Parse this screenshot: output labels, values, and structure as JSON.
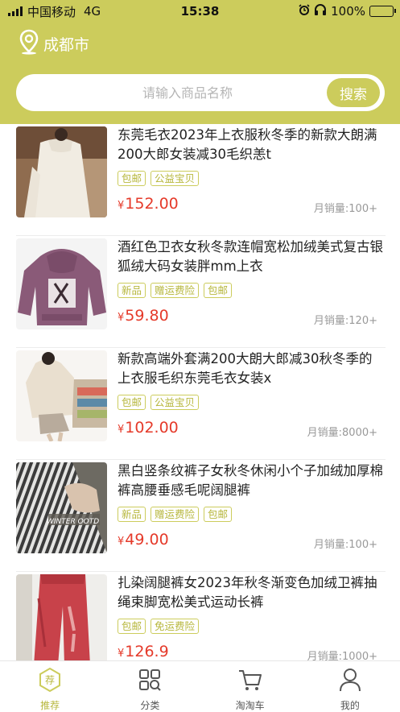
{
  "status_bar": {
    "carrier": "中国移动",
    "network": "4G",
    "time": "15:38",
    "battery": "100%",
    "battery_level": 1.0,
    "icons": [
      "signal-icon",
      "alarm-icon",
      "headphones-icon",
      "battery-charging-icon"
    ]
  },
  "header": {
    "city": "成都市",
    "location_icon": "location-pin-icon",
    "accent_color": "#cccc5c"
  },
  "search": {
    "placeholder": "请输入商品名称",
    "button_label": "搜索"
  },
  "products": [
    {
      "title": "东莞毛衣2023年上衣服秋冬季的新款大朗满200大郎女装减30毛织恙t",
      "tags": [
        "包邮",
        "公益宝贝"
      ],
      "currency": "¥",
      "price": "152.00",
      "sales": "月销量:100+"
    },
    {
      "title": "酒红色卫衣女秋冬款连帽宽松加绒美式复古银狐绒大码女装胖mm上衣",
      "tags": [
        "新品",
        "赠运费险",
        "包邮"
      ],
      "currency": "¥",
      "price": "59.80",
      "sales": "月销量:120+"
    },
    {
      "title": "新款高端外套满200大朗大郎减30秋冬季的上衣服毛织东莞毛衣女装x",
      "tags": [
        "包邮",
        "公益宝贝"
      ],
      "currency": "¥",
      "price": "102.00",
      "sales": "月销量:8000+"
    },
    {
      "title": "黑白竖条纹裤子女秋冬休闲小个子加绒加厚棉裤高腰垂感毛呢阔腿裤",
      "tags": [
        "新品",
        "赠运费险",
        "包邮"
      ],
      "currency": "¥",
      "price": "49.00",
      "sales": "月销量:100+",
      "image_caption": "WINTER OOTD"
    },
    {
      "title": "扎染阔腿裤女2023年秋冬渐变色加绒卫裤抽绳束脚宽松美式运动长裤",
      "tags": [
        "包邮",
        "免运费险"
      ],
      "currency": "¥",
      "price": "126.9",
      "sales": "月销量:1000+"
    }
  ],
  "tabbar": {
    "tabs": [
      {
        "label": "推荐",
        "icon": "recommend-icon",
        "active": true,
        "badge": "荐"
      },
      {
        "label": "分类",
        "icon": "category-icon",
        "active": false
      },
      {
        "label": "淘淘车",
        "icon": "cart-icon",
        "active": false
      },
      {
        "label": "我的",
        "icon": "profile-icon",
        "active": false
      }
    ]
  }
}
